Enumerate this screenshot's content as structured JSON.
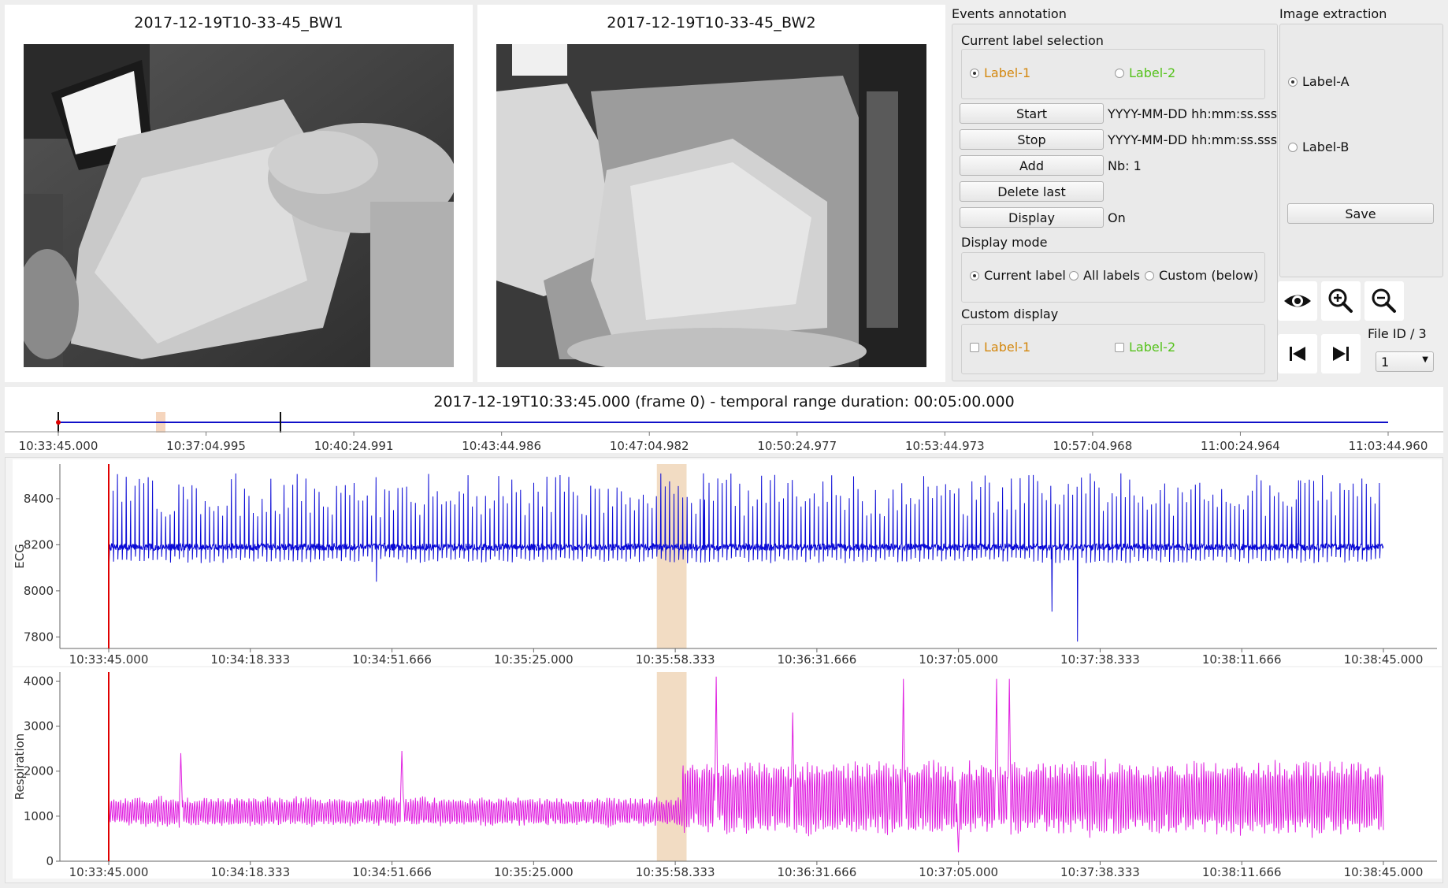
{
  "videos": [
    {
      "title": "2017-12-19T10-33-45_BW1"
    },
    {
      "title": "2017-12-19T10-33-45_BW2"
    }
  ],
  "events": {
    "title": "Events annotation",
    "current_label": {
      "title": "Current label selection",
      "label1": "Label-1",
      "label2": "Label-2",
      "label1_color": "#d4880f",
      "label2_color": "#55c21b",
      "selected": "Label-1"
    },
    "start_label": "Start",
    "start_value": "YYYY-MM-DD hh:mm:ss.sss",
    "stop_label": "Stop",
    "stop_value": "YYYY-MM-DD hh:mm:ss.sss",
    "add_label": "Add",
    "add_value": "Nb: 1",
    "delete_label": "Delete last",
    "display_label": "Display",
    "display_value": "On",
    "display_mode": {
      "title": "Display mode",
      "opt1": "Current label",
      "opt2": "All labels",
      "opt3": "Custom (below)",
      "selected": "Current label"
    },
    "custom_display": {
      "title": "Custom display",
      "label1": "Label-1",
      "label2": "Label-2"
    }
  },
  "extraction": {
    "title": "Image extraction",
    "optA": "Label-A",
    "optB": "Label-B",
    "selected": "Label-A",
    "save_label": "Save"
  },
  "toolbar": {
    "icons": [
      "eye-icon",
      "zoom-in-icon",
      "zoom-out-icon",
      "skip-back-icon",
      "skip-forward-icon"
    ]
  },
  "file_id": {
    "label": "File ID / 3",
    "value": "1"
  },
  "timeline": {
    "title": "2017-12-19T10:33:45.000 (frame 0) - temporal range duration: 00:05:00.000",
    "ticks": [
      "10:33:45.000",
      "10:37:04.995",
      "10:40:24.991",
      "10:43:44.986",
      "10:47:04.982",
      "10:50:24.977",
      "10:53:44.973",
      "10:57:04.968",
      "11:00:24.964",
      "11:03:44.960"
    ],
    "line_color": "#1010c8"
  },
  "chart_data": [
    {
      "type": "line",
      "ylabel": "ECG",
      "ylim": [
        7750,
        8550
      ],
      "yticks": [
        7800,
        8000,
        8200,
        8400
      ],
      "xticks": [
        "10:33:45.000",
        "10:34:18.333",
        "10:34:51.666",
        "10:35:25.000",
        "10:35:58.333",
        "10:36:31.666",
        "10:37:05.000",
        "10:37:38.333",
        "10:38:11.666",
        "10:38:45.000"
      ],
      "color": "#0a0ad6",
      "baseline": 8190,
      "cursor_color": "#e00000",
      "highlight_color": "#f2dcc3",
      "highlight_range": [
        "10:35:54",
        "10:36:01"
      ],
      "notable_points": [
        {
          "x": "10:34:48",
          "y": 8040
        },
        {
          "x": "10:37:27",
          "y": 7910
        },
        {
          "x": "10:37:33",
          "y": 7780
        },
        {
          "x": "10:36:05",
          "y": 8510
        },
        {
          "x": "10:38:25",
          "y": 8480
        }
      ]
    },
    {
      "type": "line",
      "ylabel": "Respiration",
      "ylim": [
        0,
        4200
      ],
      "yticks": [
        0,
        1000,
        2000,
        3000,
        4000
      ],
      "xticks": [
        "10:33:45.000",
        "10:34:18.333",
        "10:34:51.666",
        "10:35:25.000",
        "10:35:58.333",
        "10:36:31.666",
        "10:37:05.000",
        "10:37:38.333",
        "10:38:11.666",
        "10:38:45.000"
      ],
      "color": "#e020e0",
      "cursor_color": "#e00000",
      "highlight_color": "#f2dcc3",
      "notable_points": [
        {
          "x": "10:34:02",
          "y": 2400
        },
        {
          "x": "10:34:54",
          "y": 2450
        },
        {
          "x": "10:36:08",
          "y": 4100
        },
        {
          "x": "10:36:26",
          "y": 3300
        },
        {
          "x": "10:36:52",
          "y": 4050
        },
        {
          "x": "10:37:14",
          "y": 4050
        },
        {
          "x": "10:37:17",
          "y": 4050
        },
        {
          "x": "10:37:05",
          "y": 200
        }
      ]
    }
  ]
}
